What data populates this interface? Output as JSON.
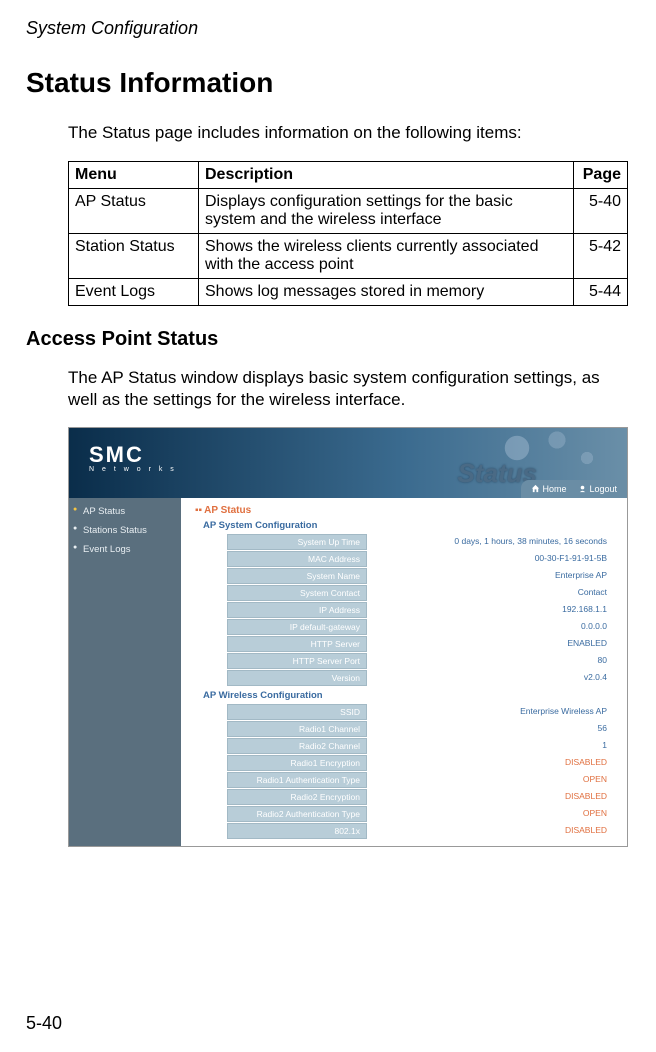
{
  "doc_header": "System Configuration",
  "h1": "Status Information",
  "intro": "The Status page includes information on the following items:",
  "menu_table": {
    "headers": {
      "menu": "Menu",
      "desc": "Description",
      "page": "Page"
    },
    "rows": [
      {
        "menu": "AP Status",
        "desc": "Displays configuration settings for the basic system and the wireless interface",
        "page": "5-40"
      },
      {
        "menu": "Station Status",
        "desc": "Shows the wireless clients currently associated with the access point",
        "page": "5-42"
      },
      {
        "menu": "Event Logs",
        "desc": "Shows log messages stored in memory",
        "page": "5-44"
      }
    ]
  },
  "h2": "Access Point Status",
  "body_text": "The AP Status window displays basic system configuration settings, as well as the settings for the wireless interface.",
  "screenshot": {
    "logo": {
      "brand": "SMC",
      "sub": "N e t w o r k s"
    },
    "status_word": "Status",
    "topbar": {
      "home": "Home",
      "logout": "Logout"
    },
    "sidebar": {
      "items": [
        {
          "label": "AP Status",
          "active": true
        },
        {
          "label": "Stations Status",
          "active": false
        },
        {
          "label": "Event Logs",
          "active": false
        }
      ]
    },
    "page_title": "AP Status",
    "sections": [
      {
        "title": "AP System Configuration",
        "rows": [
          {
            "label": "System Up Time",
            "value": "0 days, 1 hours, 38 minutes, 16 seconds"
          },
          {
            "label": "MAC Address",
            "value": "00-30-F1-91-91-5B"
          },
          {
            "label": "System Name",
            "value": "Enterprise AP"
          },
          {
            "label": "System Contact",
            "value": "Contact"
          },
          {
            "label": "IP Address",
            "value": "192.168.1.1"
          },
          {
            "label": "IP default-gateway",
            "value": "0.0.0.0"
          },
          {
            "label": "HTTP Server",
            "value": "ENABLED"
          },
          {
            "label": "HTTP Server Port",
            "value": "80"
          },
          {
            "label": "Version",
            "value": "v2.0.4"
          }
        ]
      },
      {
        "title": "AP Wireless Configuration",
        "rows": [
          {
            "label": "SSID",
            "value": "Enterprise Wireless AP"
          },
          {
            "label": "Radio1 Channel",
            "value": "56"
          },
          {
            "label": "Radio2 Channel",
            "value": "1"
          },
          {
            "label": "Radio1 Encryption",
            "value": "DISABLED",
            "orange": true
          },
          {
            "label": "Radio1 Authentication Type",
            "value": "OPEN",
            "orange": true
          },
          {
            "label": "Radio2 Encryption",
            "value": "DISABLED",
            "orange": true
          },
          {
            "label": "Radio2 Authentication Type",
            "value": "OPEN",
            "orange": true
          },
          {
            "label": "802.1x",
            "value": "DISABLED",
            "orange": true
          }
        ]
      }
    ]
  },
  "page_num": "5-40"
}
